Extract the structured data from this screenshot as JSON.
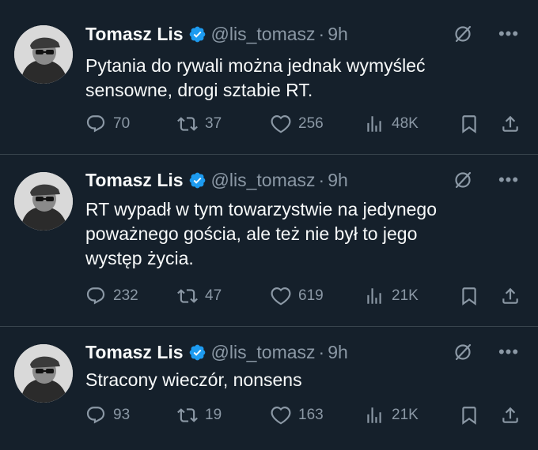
{
  "tweets": [
    {
      "author": {
        "name": "Tomasz Lis",
        "handle": "@lis_tomasz",
        "time": "9h"
      },
      "text_lines": [
        "Pytania do rywali można jednak wymyśleć",
        "sensowne, drogi sztabie RT."
      ],
      "stats": {
        "replies": "70",
        "retweets": "37",
        "likes": "256",
        "views": "48K"
      }
    },
    {
      "author": {
        "name": "Tomasz Lis",
        "handle": "@lis_tomasz",
        "time": "9h"
      },
      "text_lines": [
        "RT wypadł w tym towarzystwie na jedynego",
        "poważnego gościa, ale też nie był to jego",
        "występ życia."
      ],
      "stats": {
        "replies": "232",
        "retweets": "47",
        "likes": "619",
        "views": "21K"
      }
    },
    {
      "author": {
        "name": "Tomasz Lis",
        "handle": "@lis_tomasz",
        "time": "9h"
      },
      "text_lines": [
        "Stracony wieczór, nonsens"
      ],
      "stats": {
        "replies": "93",
        "retweets": "19",
        "likes": "163",
        "views": "21K"
      }
    }
  ],
  "ui": {
    "separator": "·",
    "more_glyph": "•••"
  },
  "colors": {
    "background": "#15202b",
    "text": "#f7f9f9",
    "muted": "#8b98a5",
    "verified": "#1d9bf0",
    "divider": "#38444d"
  }
}
